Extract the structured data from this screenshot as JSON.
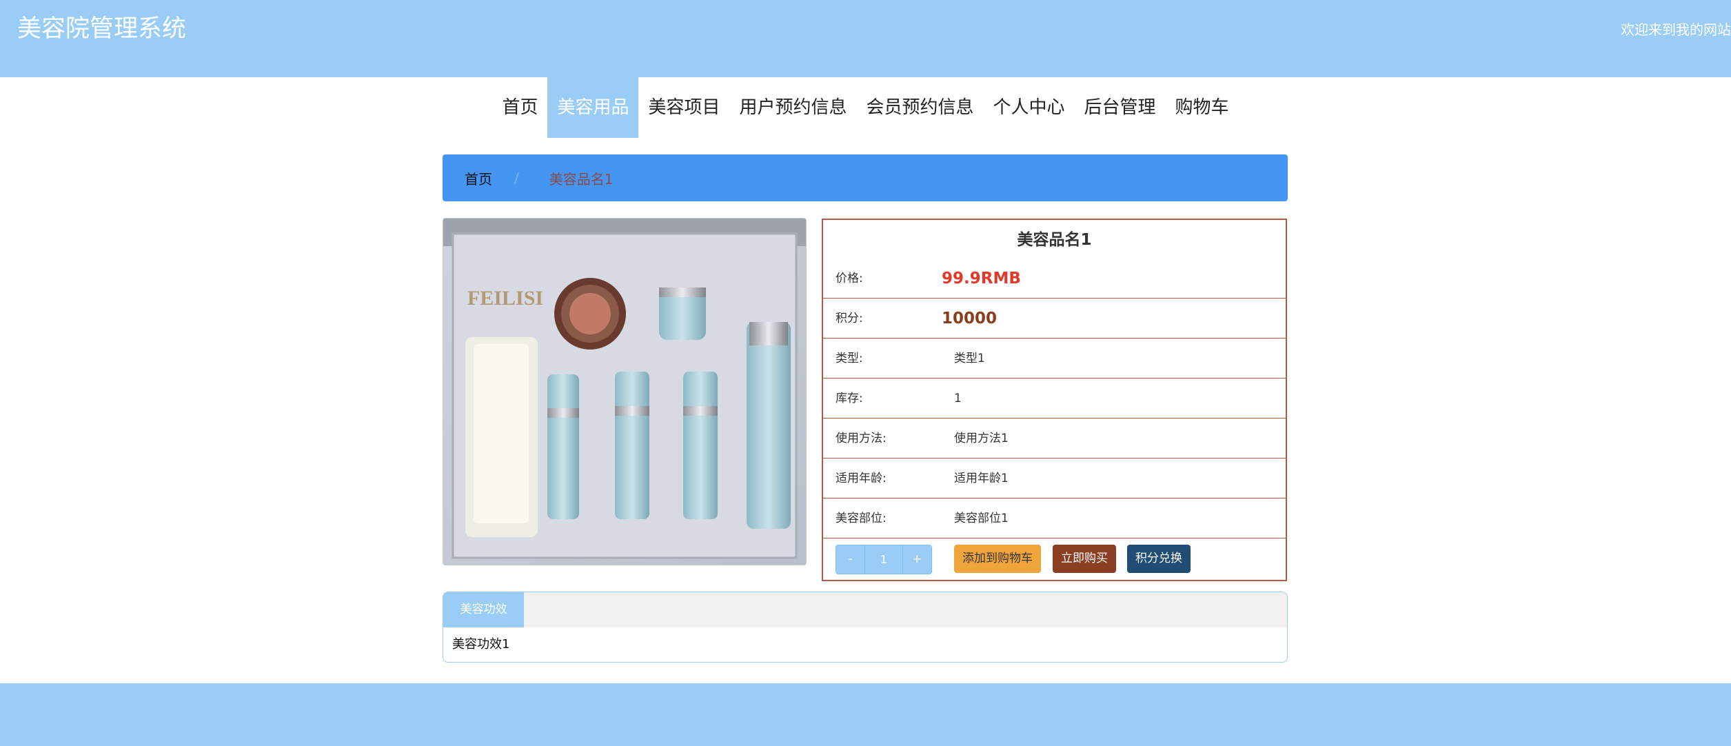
{
  "header": {
    "site_title": "美容院管理系统",
    "welcome": "欢迎来到我的网站"
  },
  "nav": {
    "items": [
      "首页",
      "美容用品",
      "美容项目",
      "用户预约信息",
      "会员预约信息",
      "个人中心",
      "后台管理",
      "购物车"
    ],
    "active_index": 1
  },
  "breadcrumb": {
    "home": "首页",
    "separator": "/",
    "current": "美容品名1"
  },
  "product": {
    "name": "美容品名1",
    "image_alt": "FEILISI",
    "rows": [
      {
        "label": "价格:",
        "value": "99.9RMB"
      },
      {
        "label": "积分:",
        "value": "10000"
      },
      {
        "label": "类型:",
        "value": "类型1"
      },
      {
        "label": "库存:",
        "value": "1"
      },
      {
        "label": "使用方法:",
        "value": "使用方法1"
      },
      {
        "label": "适用年龄:",
        "value": "适用年龄1"
      },
      {
        "label": "美容部位:",
        "value": "美容部位1"
      }
    ],
    "quantity": {
      "minus": "-",
      "value": "1",
      "plus": "+"
    },
    "buttons": {
      "add_to_cart": "添加到购物车",
      "buy_now": "立即购买",
      "redeem": "积分兑换"
    }
  },
  "tabs": {
    "active_label": "美容功效",
    "content": "美容功效1"
  },
  "colors": {
    "theme": "#99cdf5",
    "breadcrumb_bg": "#4596f3",
    "price": "#e23a2a",
    "border": "#b45a40"
  }
}
